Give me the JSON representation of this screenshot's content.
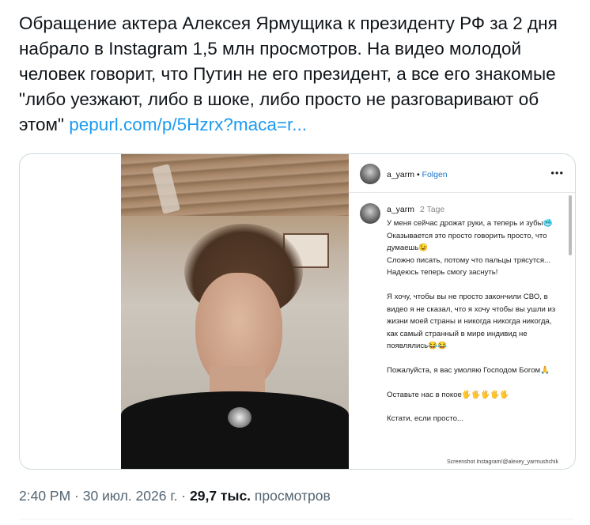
{
  "tweet": {
    "text": "Обращение актера Алексея Ярмущика к президенту РФ за 2 дня набрало в Instagram 1,5 млн просмотров. На видео молодой человек говорит, что Путин не его президент, а все его знакомые \"либо уезжают, либо в шоке, либо просто не разговаривают об этом\" ",
    "link": "pepurl.com/p/5Hzrx?maca=r..."
  },
  "instagram_post": {
    "username": "a_yarm",
    "separator": "•",
    "follow_label": "Folgen",
    "more_icon": "more-icon",
    "comment_username": "a_yarm",
    "comment_age": "2 Tage",
    "caption_paragraphs": [
      [
        "У меня сейчас дрожат руки, а теперь и зубы🥶",
        "Оказывается это просто говорить просто, что думаешь😉",
        "Сложно писать, потому что пальцы трясутся...",
        "Надеюсь теперь смогу заснуть!"
      ],
      [
        "Я хочу, чтобы вы не просто закончили СВО, в видео я не сказал, что я хочу чтобы вы ушли из жизни моей страны и никогда никогда никогда, как самый странный в мире индивид не появлялись😂😂"
      ],
      [
        "Пожалуйста, я вас умоляю Господом Богом🙏"
      ],
      [
        "Оставьте нас в покое🖐🖐🖐🖐🖐"
      ],
      [
        "Кстати, если просто..."
      ]
    ],
    "watermark": "Screenshot Instagram/@alexey_yarmushchik"
  },
  "meta": {
    "time": "2:40 PM",
    "dot1": " · ",
    "date": "30 июл. 2026 г.",
    "dot2": " · ",
    "views_count": "29,7 тыс.",
    "views_label": " просмотров"
  }
}
